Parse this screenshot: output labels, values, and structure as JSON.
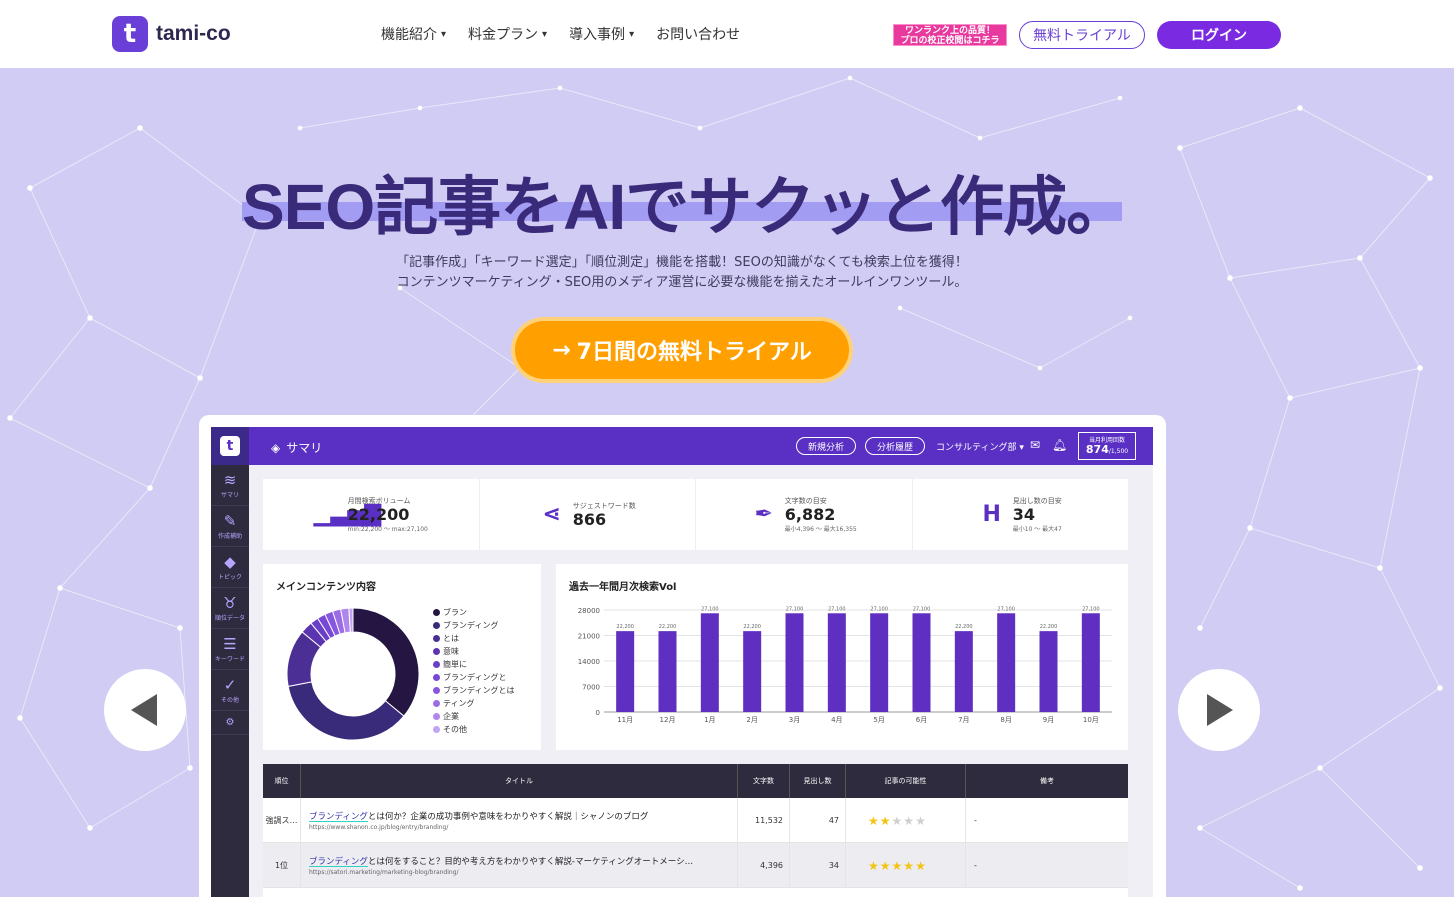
{
  "brand": {
    "name": "tami-co",
    "mark": "t",
    "accent": "#6a3fd8"
  },
  "nav": [
    {
      "label": "機能紹介"
    },
    {
      "label": "料金プラン"
    },
    {
      "label": "導入事例"
    },
    {
      "label": "お問い合わせ"
    }
  ],
  "promo": {
    "line1": "ワンランク上の品質！",
    "line2": "プロの校正校閲はコチラ"
  },
  "header_buttons": {
    "trial": "無料トライアル",
    "login": "ログイン"
  },
  "hero": {
    "headline": "SEO記事をAIでサクッと作成。",
    "sub1": "「記事作成」「キーワード選定」「順位測定」機能を搭載！SEOの知識がなくても検索上位を獲得！",
    "sub2": "コンテンツマーケティング・SEO用のメディア運営に必要な機能を揃えたオールインワンツール。",
    "cta": "7日間の無料トライアル"
  },
  "app": {
    "title": "サマリ",
    "btn_new": "新規分析",
    "btn_history": "分析履歴",
    "dept": "コンサルティング部",
    "usage_label": "当月利用回数",
    "usage_value": "874",
    "usage_total": "/1,500",
    "sidebar": [
      {
        "label": "サマリ"
      },
      {
        "label": "作成補助"
      },
      {
        "label": "トピック"
      },
      {
        "label": "順位データ"
      },
      {
        "label": "キーワード"
      },
      {
        "label": "その他"
      }
    ],
    "stats": [
      {
        "label": "月間検索ボリューム",
        "value": "22,200",
        "sub": "min:22,200 〜 max:27,100"
      },
      {
        "label": "サジェストワード数",
        "value": "866",
        "sub": ""
      },
      {
        "label": "文字数の目安",
        "value": "6,882",
        "sub": "最小4,396 〜 最大16,355"
      },
      {
        "label": "見出し数の目安",
        "value": "34",
        "sub": "最小10 〜 最大47"
      }
    ],
    "donut_title": "メインコンテンツ内容",
    "bar_title": "過去一年間月次検索Vol",
    "table_headers": [
      "順位",
      "タイトル",
      "文字数",
      "見出し数",
      "記事の可能性",
      "備考"
    ],
    "rows": [
      {
        "rank": "強調ス…",
        "title_hl": "ブランディング",
        "title_rest": "とは何か？企業の成功事例や意味をわかりやすく解説｜シャノンのブログ",
        "url": "https://www.shanon.co.jp/blog/entry/branding/",
        "chars": "11,532",
        "heads": "47",
        "stars": 2,
        "note": "-"
      },
      {
        "rank": "1位",
        "title_hl": "ブランディング",
        "title_rest": "とは何をすること？目的や考え方をわかりやすく解説-マーケティングオートメーシ…",
        "url": "https://satori.marketing/marketing-blog/branding/",
        "chars": "4,396",
        "heads": "34",
        "stars": 5,
        "note": "-"
      }
    ]
  },
  "chart_data": [
    {
      "type": "pie",
      "title": "メインコンテンツ内容",
      "categories": [
        "ブラン",
        "ブランディング",
        "とは",
        "意味",
        "簡単に",
        "ブランディングと",
        "ブランディングとは",
        "ティング",
        "企業",
        "その他"
      ],
      "values": [
        36,
        36,
        14,
        3,
        2,
        2,
        2,
        2,
        2,
        1
      ],
      "colors": [
        "#241543",
        "#3a2a7a",
        "#4b2f95",
        "#5b35b0",
        "#6a3fc8",
        "#7748d6",
        "#8857df",
        "#9b6ce6",
        "#ae86ec",
        "#c2a4f2"
      ]
    },
    {
      "type": "bar",
      "title": "過去一年間月次検索Vol",
      "categories": [
        "11月",
        "12月",
        "1月",
        "2月",
        "3月",
        "4月",
        "5月",
        "6月",
        "7月",
        "8月",
        "9月",
        "10月"
      ],
      "values": [
        22200,
        22200,
        27100,
        22200,
        27100,
        27100,
        27100,
        27100,
        22200,
        27100,
        22200,
        27100
      ],
      "value_labels": [
        "22,200",
        "22,200",
        "27,100",
        "22,200",
        "27,100",
        "27,100",
        "27,100",
        "27,100",
        "22,200",
        "27,100",
        "22,200",
        "27,100"
      ],
      "yticks": [
        0,
        7000,
        14000,
        21000,
        28000
      ],
      "ylim": [
        0,
        28000
      ],
      "color": "#5f2fc1"
    }
  ]
}
